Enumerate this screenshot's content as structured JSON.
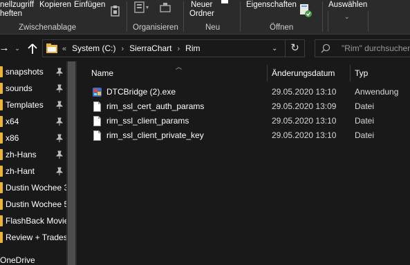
{
  "ribbon": {
    "clipboard": {
      "pin_label": "nellzugriff",
      "pin_label2": "heften",
      "copy_label": "Kopieren",
      "paste_label": "Einfügen",
      "group_label": "Zwischenablage"
    },
    "organize": {
      "group_label": "Organisieren"
    },
    "new": {
      "new_folder_line1": "Neuer",
      "new_folder_line2": "Ordner",
      "group_label": "Neu"
    },
    "open": {
      "properties_label": "Eigenschaften",
      "group_label": "Öffnen"
    },
    "select": {
      "select_label": "Auswählen"
    }
  },
  "address": {
    "crumbs": [
      "System (C:)",
      "SierraChart",
      "Rim"
    ],
    "overflow": "«"
  },
  "search": {
    "placeholder": "\"Rim\" durchsuchen"
  },
  "sidebar": {
    "items": [
      {
        "label": "snapshots",
        "pinned": true
      },
      {
        "label": "sounds",
        "pinned": true
      },
      {
        "label": "Templates",
        "pinned": true
      },
      {
        "label": "x64",
        "pinned": true
      },
      {
        "label": "x86",
        "pinned": true
      },
      {
        "label": "zh-Hans",
        "pinned": true
      },
      {
        "label": "zh-Hant",
        "pinned": true
      },
      {
        "label": "Dustin Wochee 3",
        "pinned": false
      },
      {
        "label": "Dustin Wochee 5",
        "pinned": false
      },
      {
        "label": "FlashBack Movie",
        "pinned": false
      },
      {
        "label": "Review + Trades",
        "pinned": false
      }
    ],
    "onedrive": "OneDrive"
  },
  "columns": {
    "name": "Name",
    "date": "Änderungsdatum",
    "type": "Typ"
  },
  "files": [
    {
      "name": "DTCBridge (2).exe",
      "date": "29.05.2020 13:10",
      "type": "Anwendung",
      "icon": "exe-icon"
    },
    {
      "name": "rim_ssl_cert_auth_params",
      "date": "29.05.2020 13:09",
      "type": "Datei",
      "icon": "file-icon"
    },
    {
      "name": "rim_ssl_client_params",
      "date": "29.05.2020 13:10",
      "type": "Datei",
      "icon": "file-icon"
    },
    {
      "name": "rim_ssl_client_private_key",
      "date": "29.05.2020 13:10",
      "type": "Datei",
      "icon": "file-icon"
    }
  ],
  "colors": {
    "folder": "#e8b43c",
    "background": "#191919",
    "ribbon": "#2b2b2b"
  }
}
